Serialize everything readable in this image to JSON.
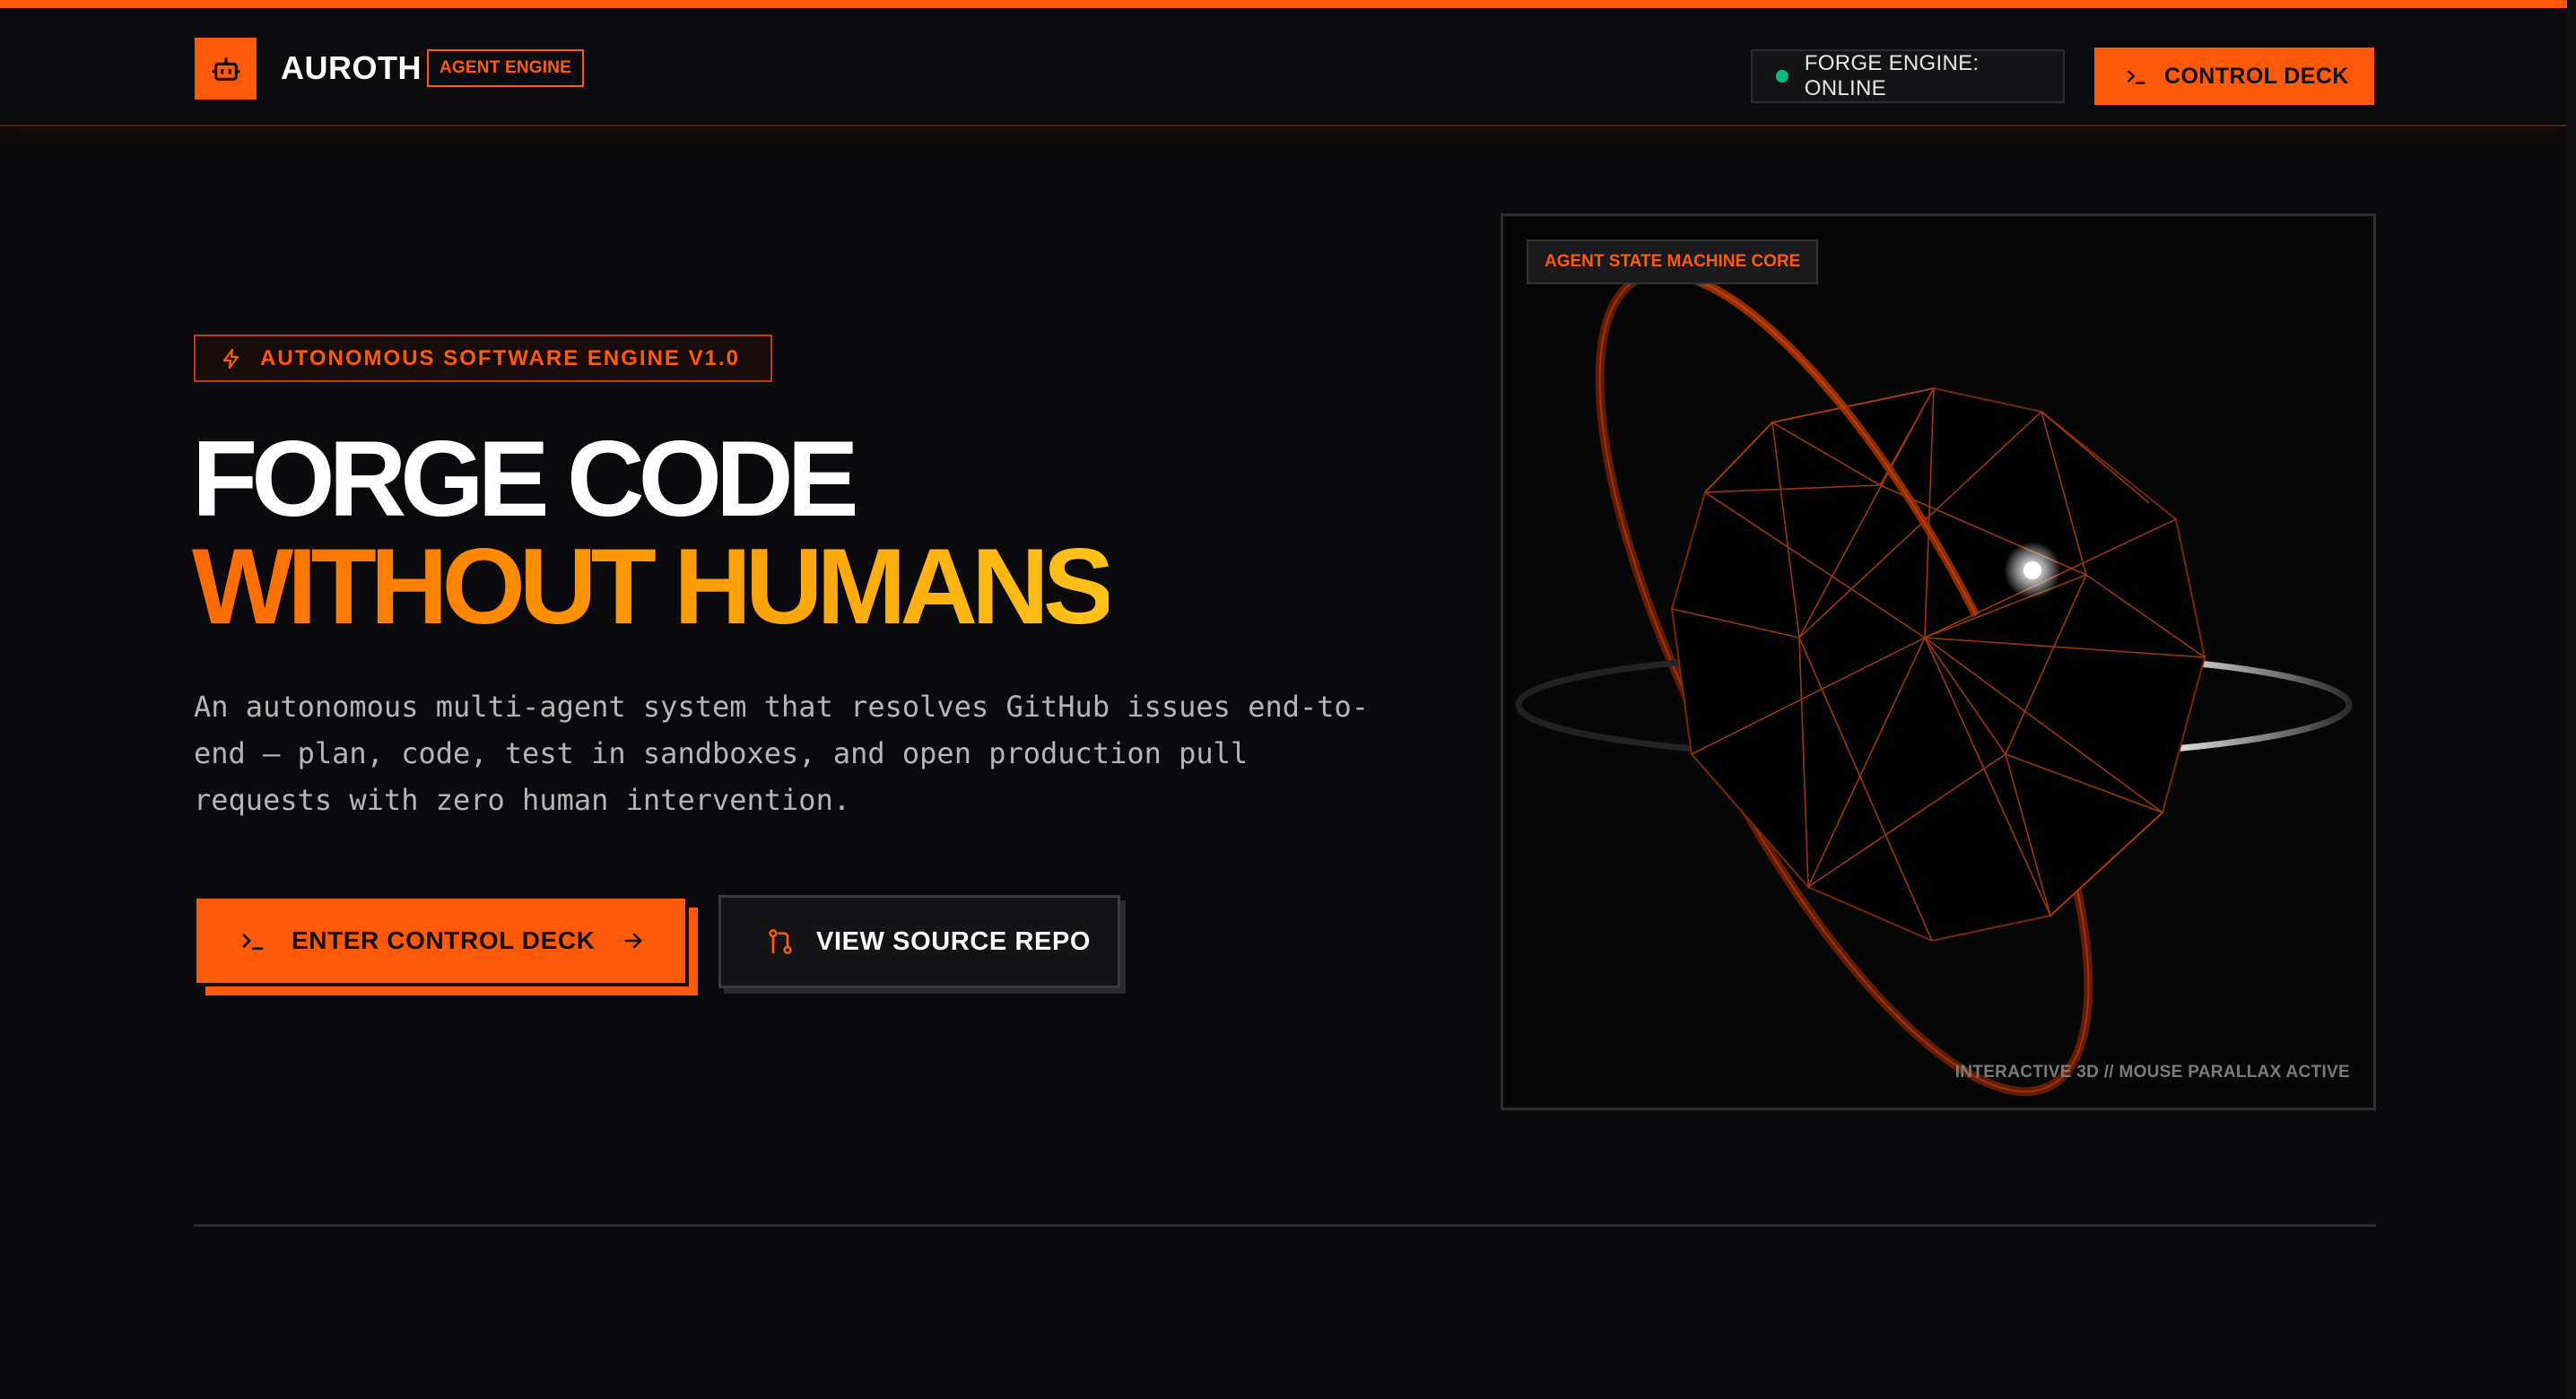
{
  "nav": {
    "brand": "AUROTH",
    "brand_badge": "AGENT ENGINE",
    "status_text": "FORGE ENGINE: ONLINE",
    "cta_label": "CONTROL DECK",
    "logo_icon": "robot-icon",
    "cta_icon": "terminal-icon"
  },
  "hero": {
    "badge": "AUTONOMOUS SOFTWARE ENGINE V1.0",
    "badge_icon": "lightning-icon",
    "title_line1": "FORGE CODE",
    "title_line2": "WITHOUT HUMANS",
    "description": "An autonomous multi-agent system that resolves GitHub issues end-to-end — plan, code, test in sandboxes, and open production pull requests with zero human intervention.",
    "primary_button": "ENTER CONTROL DECK",
    "secondary_button": "VIEW SOURCE REPO"
  },
  "visual": {
    "badge": "AGENT STATE MACHINE CORE",
    "caption": "INTERACTIVE 3D // MOUSE PARALLAX ACTIVE"
  },
  "colors": {
    "accent": "#ff5a0a",
    "status_online": "#10b981",
    "background": "#0a0a0c"
  }
}
